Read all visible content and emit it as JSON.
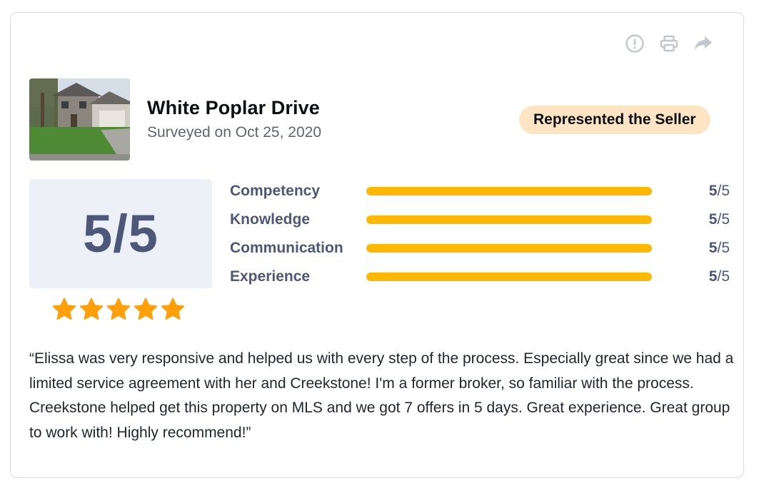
{
  "header_actions": [
    {
      "name": "report-icon"
    },
    {
      "name": "print-icon"
    },
    {
      "name": "share-icon"
    }
  ],
  "property": {
    "title": "White Poplar Drive",
    "surveyed": "Surveyed on Oct 25, 2020",
    "badge": "Represented the Seller"
  },
  "overall": {
    "score_text": "5/5",
    "stars": 5,
    "star_color": "#ff9f0a"
  },
  "ratings": [
    {
      "label": "Competency",
      "score": "5",
      "out_of": "/5",
      "value": 5
    },
    {
      "label": "Knowledge",
      "score": "5",
      "out_of": "/5",
      "value": 5
    },
    {
      "label": "Communication",
      "score": "5",
      "out_of": "/5",
      "value": 5
    },
    {
      "label": "Experience",
      "score": "5",
      "out_of": "/5",
      "value": 5
    }
  ],
  "max_score": 5,
  "review_text": "“Elissa was very responsive and helped us with every step of the process. Especially great since we had a limited service agreement with her and Creekstone! I'm a former broker, so familiar with the process. Creekstone helped get this property on MLS and we got 7 offers in 5 days. Great experience. Great group to work with! Highly recommend!”",
  "colors": {
    "bar_fill": "#ffb800",
    "accent_text": "#4d5779",
    "badge_bg": "#fde4c3"
  }
}
